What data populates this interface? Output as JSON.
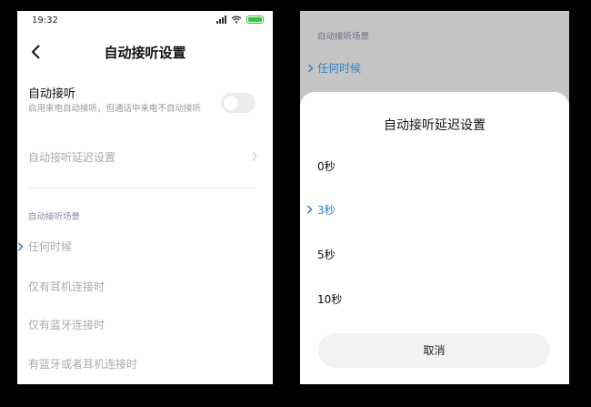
{
  "left": {
    "status": {
      "time": "19:32"
    },
    "title": "自动接听设置",
    "auto_answer": {
      "title": "自动接听",
      "desc": "启用来电自动接听，但通话中来电不自动接听",
      "enabled": false
    },
    "delay_row": {
      "label": "自动接听延迟设置"
    },
    "section_label": "自动接听场景",
    "scenes": [
      "任何时候",
      "仅有耳机连接时",
      "仅有蓝牙连接时",
      "有蓝牙或者耳机连接时"
    ],
    "selected_scene_index": 0
  },
  "right": {
    "section_label": "自动接听场景",
    "selected_scene": "任何时候",
    "dialog": {
      "title": "自动接听延迟设置",
      "options": [
        "0秒",
        "3秒",
        "5秒",
        "10秒"
      ],
      "selected_index": 1,
      "cancel": "取消"
    }
  },
  "colors": {
    "accent": "#2f7fbf",
    "battery": "#35c43f",
    "muted_text": "#aaaaaa",
    "overlay": "#c4c4c4"
  },
  "icons": [
    "back-arrow-icon",
    "chevron-right-icon",
    "selected-chevron-icon",
    "signal-icon",
    "wifi-icon",
    "battery-icon"
  ]
}
